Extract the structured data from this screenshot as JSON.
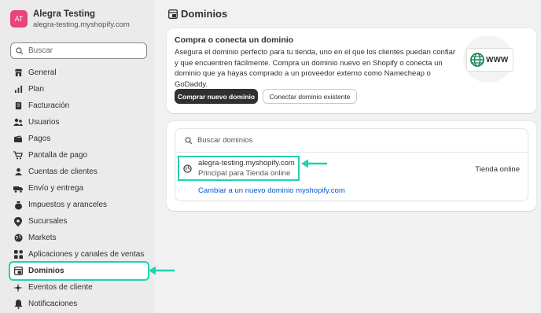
{
  "store": {
    "avatar": "AT",
    "name": "Alegra Testing",
    "domain": "alegra-testing.myshopify.com"
  },
  "sidebar": {
    "search_placeholder": "Buscar",
    "items": [
      {
        "label": "General",
        "icon": "store-icon"
      },
      {
        "label": "Plan",
        "icon": "chart-icon"
      },
      {
        "label": "Facturación",
        "icon": "receipt-icon"
      },
      {
        "label": "Usuarios",
        "icon": "users-icon"
      },
      {
        "label": "Pagos",
        "icon": "payment-icon"
      },
      {
        "label": "Pantalla de pago",
        "icon": "cart-icon"
      },
      {
        "label": "Cuentas de clientes",
        "icon": "person-icon"
      },
      {
        "label": "Envío y entrega",
        "icon": "truck-icon"
      },
      {
        "label": "Impuestos y aranceles",
        "icon": "tax-icon"
      },
      {
        "label": "Sucursales",
        "icon": "location-icon"
      },
      {
        "label": "Markets",
        "icon": "globe-icon"
      },
      {
        "label": "Aplicaciones y canales de ventas",
        "icon": "apps-icon"
      },
      {
        "label": "Dominios",
        "icon": "domain-icon"
      },
      {
        "label": "Eventos de cliente",
        "icon": "sparkle-icon"
      },
      {
        "label": "Notificaciones",
        "icon": "bell-icon"
      }
    ],
    "active_index": 12
  },
  "page": {
    "title": "Dominios"
  },
  "connect_card": {
    "title": "Compra o conecta un dominio",
    "body": "Asegura el dominio perfecto para tu tienda, uno en el que los clientes puedan confiar y que encuentren fácilmente. Compra un dominio nuevo en Shopify o conecta un dominio que ya hayas comprado a un proveedor externo como Namecheap o GoDaddy.",
    "primary_button": "Comprar nuevo dominio",
    "secondary_button": "Conectar dominio existente",
    "illustration_text": "WWW"
  },
  "domains_card": {
    "search_placeholder": "Buscar dominios",
    "domain": {
      "name": "alegra-testing.myshopify.com",
      "subtitle": "Principal para Tienda online",
      "status": "Tienda online"
    },
    "change_link": "Cambiar a un nuevo dominio myshopify.com"
  },
  "colors": {
    "highlight": "#1fd2b1",
    "avatar": "#e9437a",
    "link": "#005bd3",
    "primary_button": "#303030"
  }
}
